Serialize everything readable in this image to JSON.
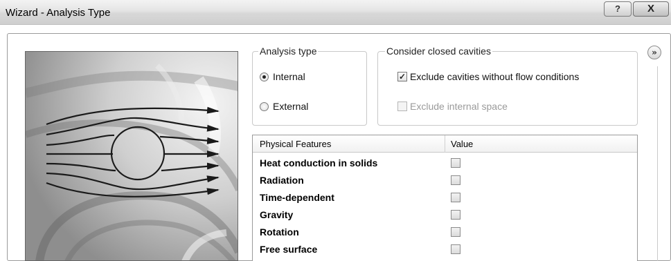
{
  "window": {
    "title": "Wizard - Analysis Type",
    "help_label": "?",
    "close_label": "X"
  },
  "analysis_type": {
    "title": "Analysis type",
    "options": [
      {
        "label": "Internal",
        "selected": true
      },
      {
        "label": "External",
        "selected": false
      }
    ]
  },
  "cavities": {
    "title": "Consider closed cavities",
    "options": [
      {
        "label": "Exclude cavities without flow conditions",
        "checked": true,
        "enabled": true
      },
      {
        "label": "Exclude internal space",
        "checked": false,
        "enabled": false
      }
    ]
  },
  "features_table": {
    "headers": [
      "Physical Features",
      "Value"
    ],
    "rows": [
      {
        "label": "Heat conduction in solids",
        "checked": false
      },
      {
        "label": "Radiation",
        "checked": false
      },
      {
        "label": "Time-dependent",
        "checked": false
      },
      {
        "label": "Gravity",
        "checked": false
      },
      {
        "label": "Rotation",
        "checked": false
      },
      {
        "label": "Free surface",
        "checked": false
      }
    ]
  },
  "expand_button": {
    "label": "»"
  },
  "icons": {
    "illustration": "internal-flow-illustration",
    "expand": "double-chevron-right-icon"
  }
}
